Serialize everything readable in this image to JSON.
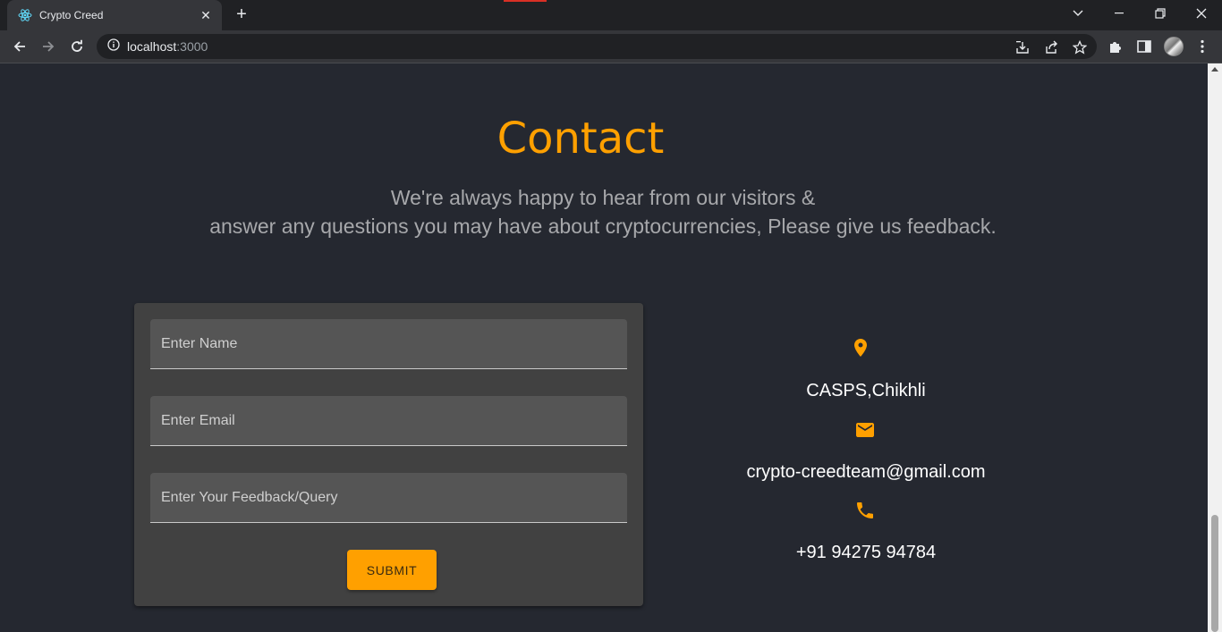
{
  "browser": {
    "tab_title": "Crypto Creed",
    "url_host": "localhost",
    "url_port": ":3000"
  },
  "contact": {
    "heading": "Contact",
    "subtext_line1": "We're always happy to hear from our visitors &",
    "subtext_line2": "answer any questions you may have about cryptocurrencies, Please give us feedback.",
    "form": {
      "name_placeholder": "Enter Name",
      "email_placeholder": "Enter Email",
      "feedback_placeholder": "Enter Your Feedback/Query",
      "submit_label": "SUBMIT"
    },
    "info": {
      "location": "CASPS,Chikhli",
      "email": "crypto-creedteam@gmail.com",
      "phone": "+91 94275 94784",
      "icon_color": "#ffa000"
    }
  },
  "colors": {
    "accent": "#ffa000",
    "page_bg": "#252830",
    "card_bg": "#414141"
  }
}
